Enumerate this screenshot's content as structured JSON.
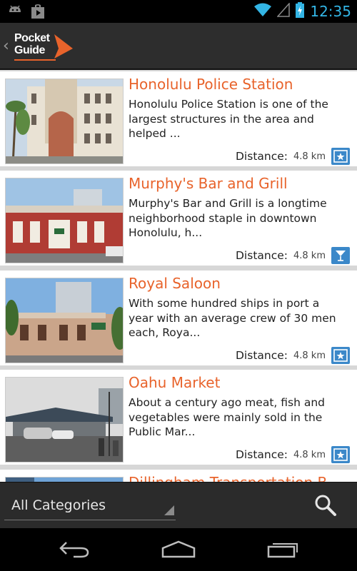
{
  "status_bar": {
    "time": "12:35",
    "icons": [
      "android-debug-icon",
      "play-store-icon",
      "wifi-icon",
      "signal-icon",
      "battery-charging-icon"
    ]
  },
  "action_bar": {
    "logo_line1": "Pocket",
    "logo_line2": "Guide",
    "accent": "#e8632b"
  },
  "places": [
    {
      "name": "Honolulu Police Station",
      "description": "Honolulu Police Station is one of the largest structures in the area and helped ...",
      "distance_label": "Distance:",
      "distance": "4.8 km",
      "category_icon": "star-sign-icon"
    },
    {
      "name": "Murphy's Bar and Grill",
      "description": "Murphy's Bar and Grill is a longtime neighborhood staple in downtown Honolulu, h...",
      "distance_label": "Distance:",
      "distance": "4.8 km",
      "category_icon": "cocktail-icon"
    },
    {
      "name": "Royal Saloon",
      "description": "With some hundred ships in port a year with an average crew of 30 men each, Roya...",
      "distance_label": "Distance:",
      "distance": "4.8 km",
      "category_icon": "star-sign-icon"
    },
    {
      "name": "Oahu Market",
      "description": "About a century ago meat, fish and vegetables were mainly sold in the Public Mar...",
      "distance_label": "Distance:",
      "distance": "4.8 km",
      "category_icon": "star-sign-icon"
    },
    {
      "name": "Dillingham Transportation B",
      "description": "",
      "distance_label": "",
      "distance": "",
      "category_icon": ""
    }
  ],
  "bottom_bar": {
    "category_filter": "All Categories",
    "search_icon": "search-icon"
  },
  "nav_bar": {
    "buttons": [
      "back-icon",
      "home-icon",
      "recent-apps-icon"
    ]
  },
  "colors": {
    "title": "#e8632b",
    "category_icon_bg": "#3b88c9",
    "status_accent": "#33b5e5"
  }
}
